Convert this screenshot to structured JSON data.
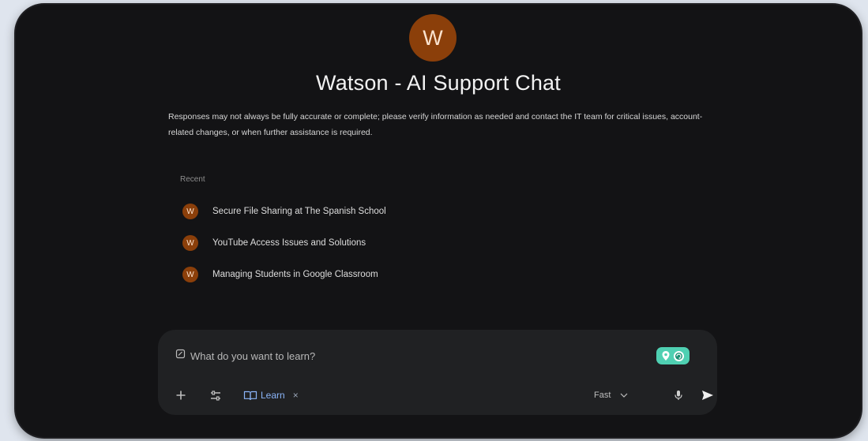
{
  "header": {
    "avatar_letter": "W",
    "title": "Watson - AI Support Chat",
    "disclaimer": "Responses may not always be fully accurate or complete; please verify information as needed and contact the IT team for critical issues, account-related changes, or when further assistance is required."
  },
  "recent": {
    "label": "Recent",
    "items": [
      {
        "avatar": "W",
        "label": "Secure File Sharing at The Spanish School"
      },
      {
        "avatar": "W",
        "label": "YouTube Access Issues and Solutions"
      },
      {
        "avatar": "W",
        "label": "Managing Students in Google Classroom"
      }
    ]
  },
  "composer": {
    "placeholder": "What do you want to learn?",
    "chip_label": "Learn",
    "chip_close": "×",
    "mode_label": "Fast"
  },
  "icons": {
    "input": "edit-note-icon",
    "badge": "grammar-extension-icon",
    "add": "plus-icon",
    "tools": "tune-icon",
    "chip": "learn-book-icon",
    "mode": "chevron-down-icon",
    "mic": "microphone-icon",
    "send": "send-icon"
  },
  "colors": {
    "window": "#131315",
    "accent_avatar": "#8b3f0a",
    "input_card": "#202123",
    "chip_text": "#8ab4f8",
    "badge": "#4fd0b2"
  }
}
